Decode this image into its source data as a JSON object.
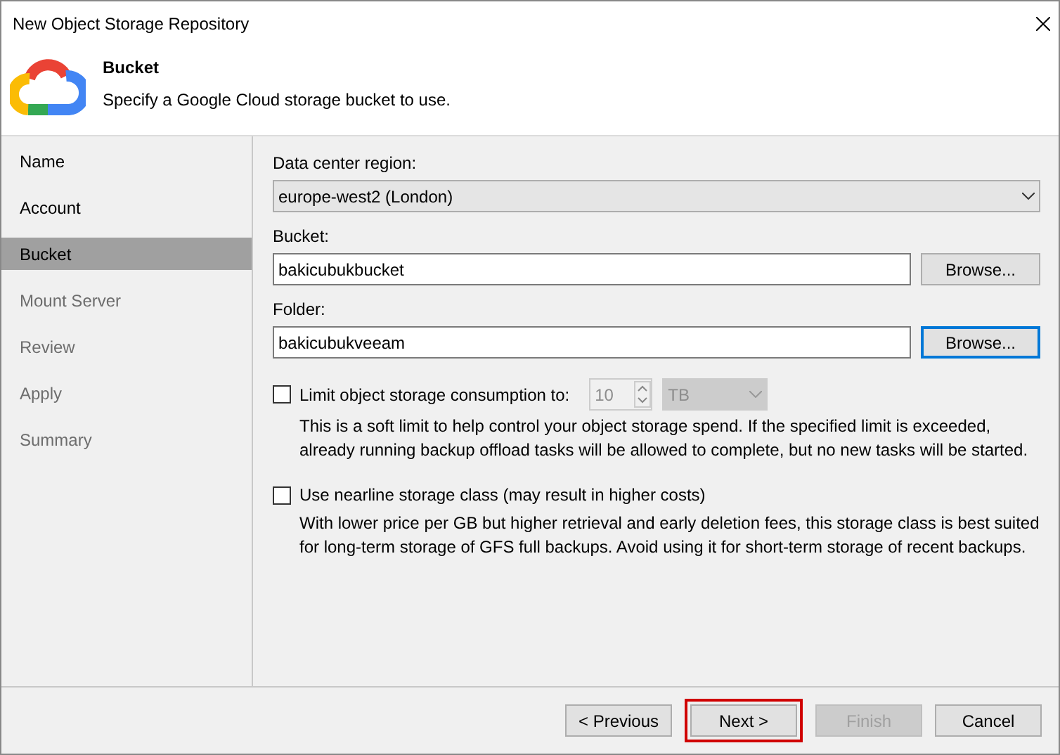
{
  "window": {
    "title": "New Object Storage Repository"
  },
  "header": {
    "title": "Bucket",
    "subtitle": "Specify a Google Cloud storage bucket to use."
  },
  "steps": [
    {
      "label": "Name",
      "selected": false,
      "disabled": false
    },
    {
      "label": "Account",
      "selected": false,
      "disabled": false
    },
    {
      "label": "Bucket",
      "selected": true,
      "disabled": false
    },
    {
      "label": "Mount Server",
      "selected": false,
      "disabled": true
    },
    {
      "label": "Review",
      "selected": false,
      "disabled": true
    },
    {
      "label": "Apply",
      "selected": false,
      "disabled": true
    },
    {
      "label": "Summary",
      "selected": false,
      "disabled": true
    }
  ],
  "region": {
    "label": "Data center region:",
    "value": "europe-west2 (London)"
  },
  "bucket": {
    "label": "Bucket:",
    "value": "bakicubukbucket",
    "button": "Browse..."
  },
  "folder": {
    "label": "Folder:",
    "value": "bakicubukveeam",
    "button": "Browse...",
    "button_focused": true
  },
  "options": [
    {
      "kind": "limit",
      "label": "Limit object storage consumption to:",
      "checked": false,
      "amount": "10",
      "unit": "TB",
      "description": "This is a soft limit to help control your object storage spend. If the specified limit is exceeded, already running backup offload tasks will be allowed to complete, but no new tasks will be started."
    },
    {
      "kind": "plain",
      "label": "Use nearline storage class (may result in higher costs)",
      "checked": false,
      "description": "With lower price per GB but higher retrieval and early deletion fees, this storage class is best suited for long-term storage of GFS full backups. Avoid using it for short-term storage of recent backups."
    }
  ],
  "buttons": [
    {
      "label": "< Previous",
      "disabled": false,
      "highlighted": false
    },
    {
      "label": "Next >",
      "disabled": false,
      "highlighted": true
    },
    {
      "label": "Finish",
      "disabled": true,
      "highlighted": false
    },
    {
      "label": "Cancel",
      "disabled": false,
      "highlighted": false
    }
  ]
}
